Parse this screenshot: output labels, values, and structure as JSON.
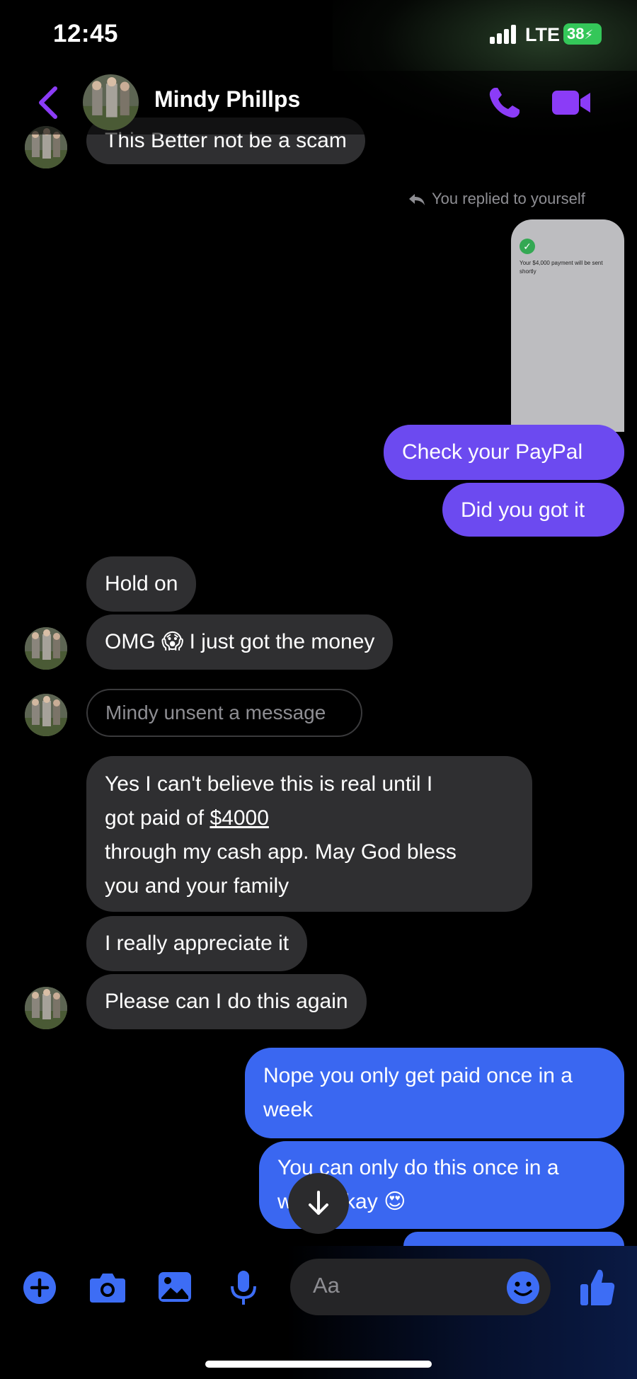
{
  "status_bar": {
    "time": "12:45",
    "network": "LTE",
    "battery": "38"
  },
  "header": {
    "contact_name": "Mindy Phillps",
    "icons": [
      "back-chevron-icon",
      "phone-icon",
      "video-camera-icon"
    ],
    "accent_color": "#8b3cf7"
  },
  "reply_notice": "You replied to yourself",
  "screenshot_attachment": {
    "text": "Your $4,000 payment will be sent shortly"
  },
  "messages": {
    "m1": "This Better not be a scam",
    "m2": "Check your PayPal",
    "m3": "Did you got it",
    "m4": "Hold on",
    "m5": "OMG 😱 I just got the money",
    "m6": "Mindy unsent a message",
    "m7_line1": "Yes I can't believe this is real until I",
    "m7_line2_pre": "got paid of ",
    "m7_amount": "$4000",
    "m7_line3": "through my cash app. May God bless",
    "m7_line4": "you and your family",
    "m8": "I really appreciate it",
    "m9": "Please can I do this again",
    "m10": "Nope you only get paid once in a week",
    "m11": "You can only do this once in a week okay 😍"
  },
  "composer": {
    "placeholder": "Aa",
    "icons": [
      "plus-icon",
      "camera-icon",
      "photo-icon",
      "microphone-icon",
      "emoji-icon",
      "thumbs-up-icon"
    ],
    "accent_color": "#3d6df5"
  }
}
